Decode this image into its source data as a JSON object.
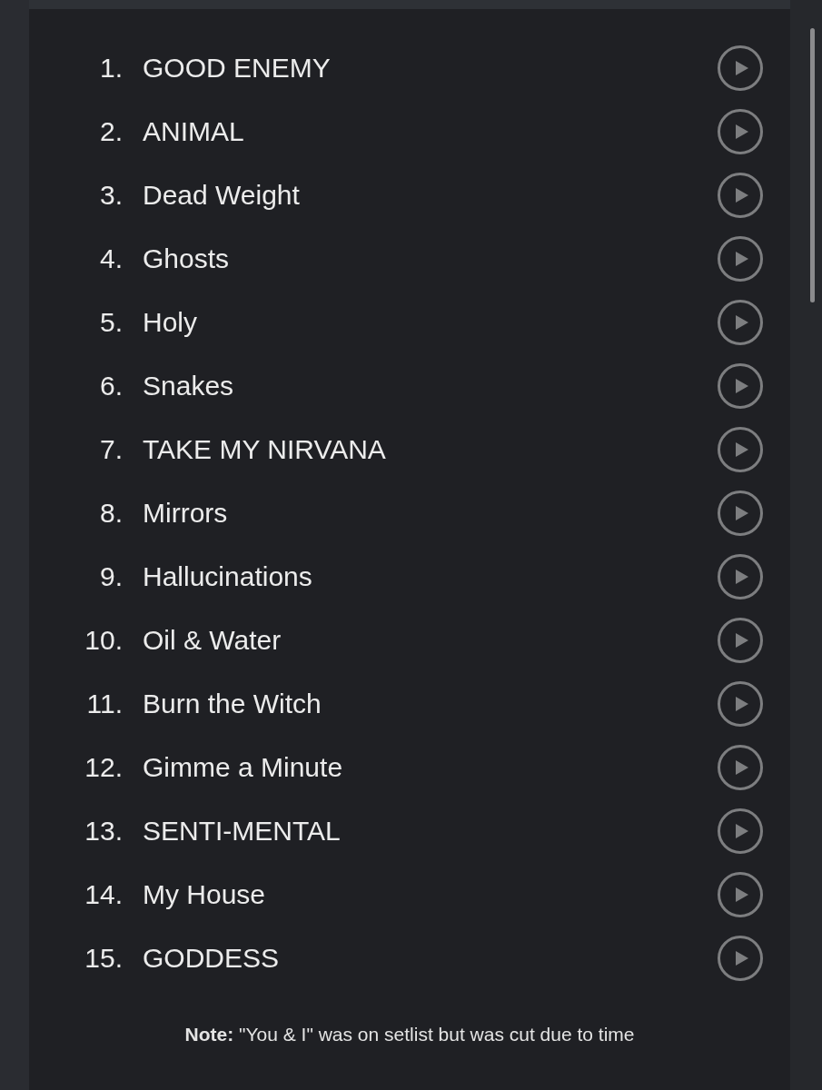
{
  "tracks": [
    {
      "number": "1.",
      "title": "GOOD ENEMY"
    },
    {
      "number": "2.",
      "title": "ANIMAL"
    },
    {
      "number": "3.",
      "title": "Dead Weight"
    },
    {
      "number": "4.",
      "title": "Ghosts"
    },
    {
      "number": "5.",
      "title": "Holy"
    },
    {
      "number": "6.",
      "title": "Snakes"
    },
    {
      "number": "7.",
      "title": "TAKE MY NIRVANA"
    },
    {
      "number": "8.",
      "title": "Mirrors"
    },
    {
      "number": "9.",
      "title": "Hallucinations"
    },
    {
      "number": "10.",
      "title": "Oil & Water"
    },
    {
      "number": "11.",
      "title": "Burn the Witch"
    },
    {
      "number": "12.",
      "title": "Gimme a Minute"
    },
    {
      "number": "13.",
      "title": "SENTI-MENTAL"
    },
    {
      "number": "14.",
      "title": "My House"
    },
    {
      "number": "15.",
      "title": "GODDESS"
    }
  ],
  "note": "**Note:** \"You & I\" was on setlist but was cut due to time"
}
